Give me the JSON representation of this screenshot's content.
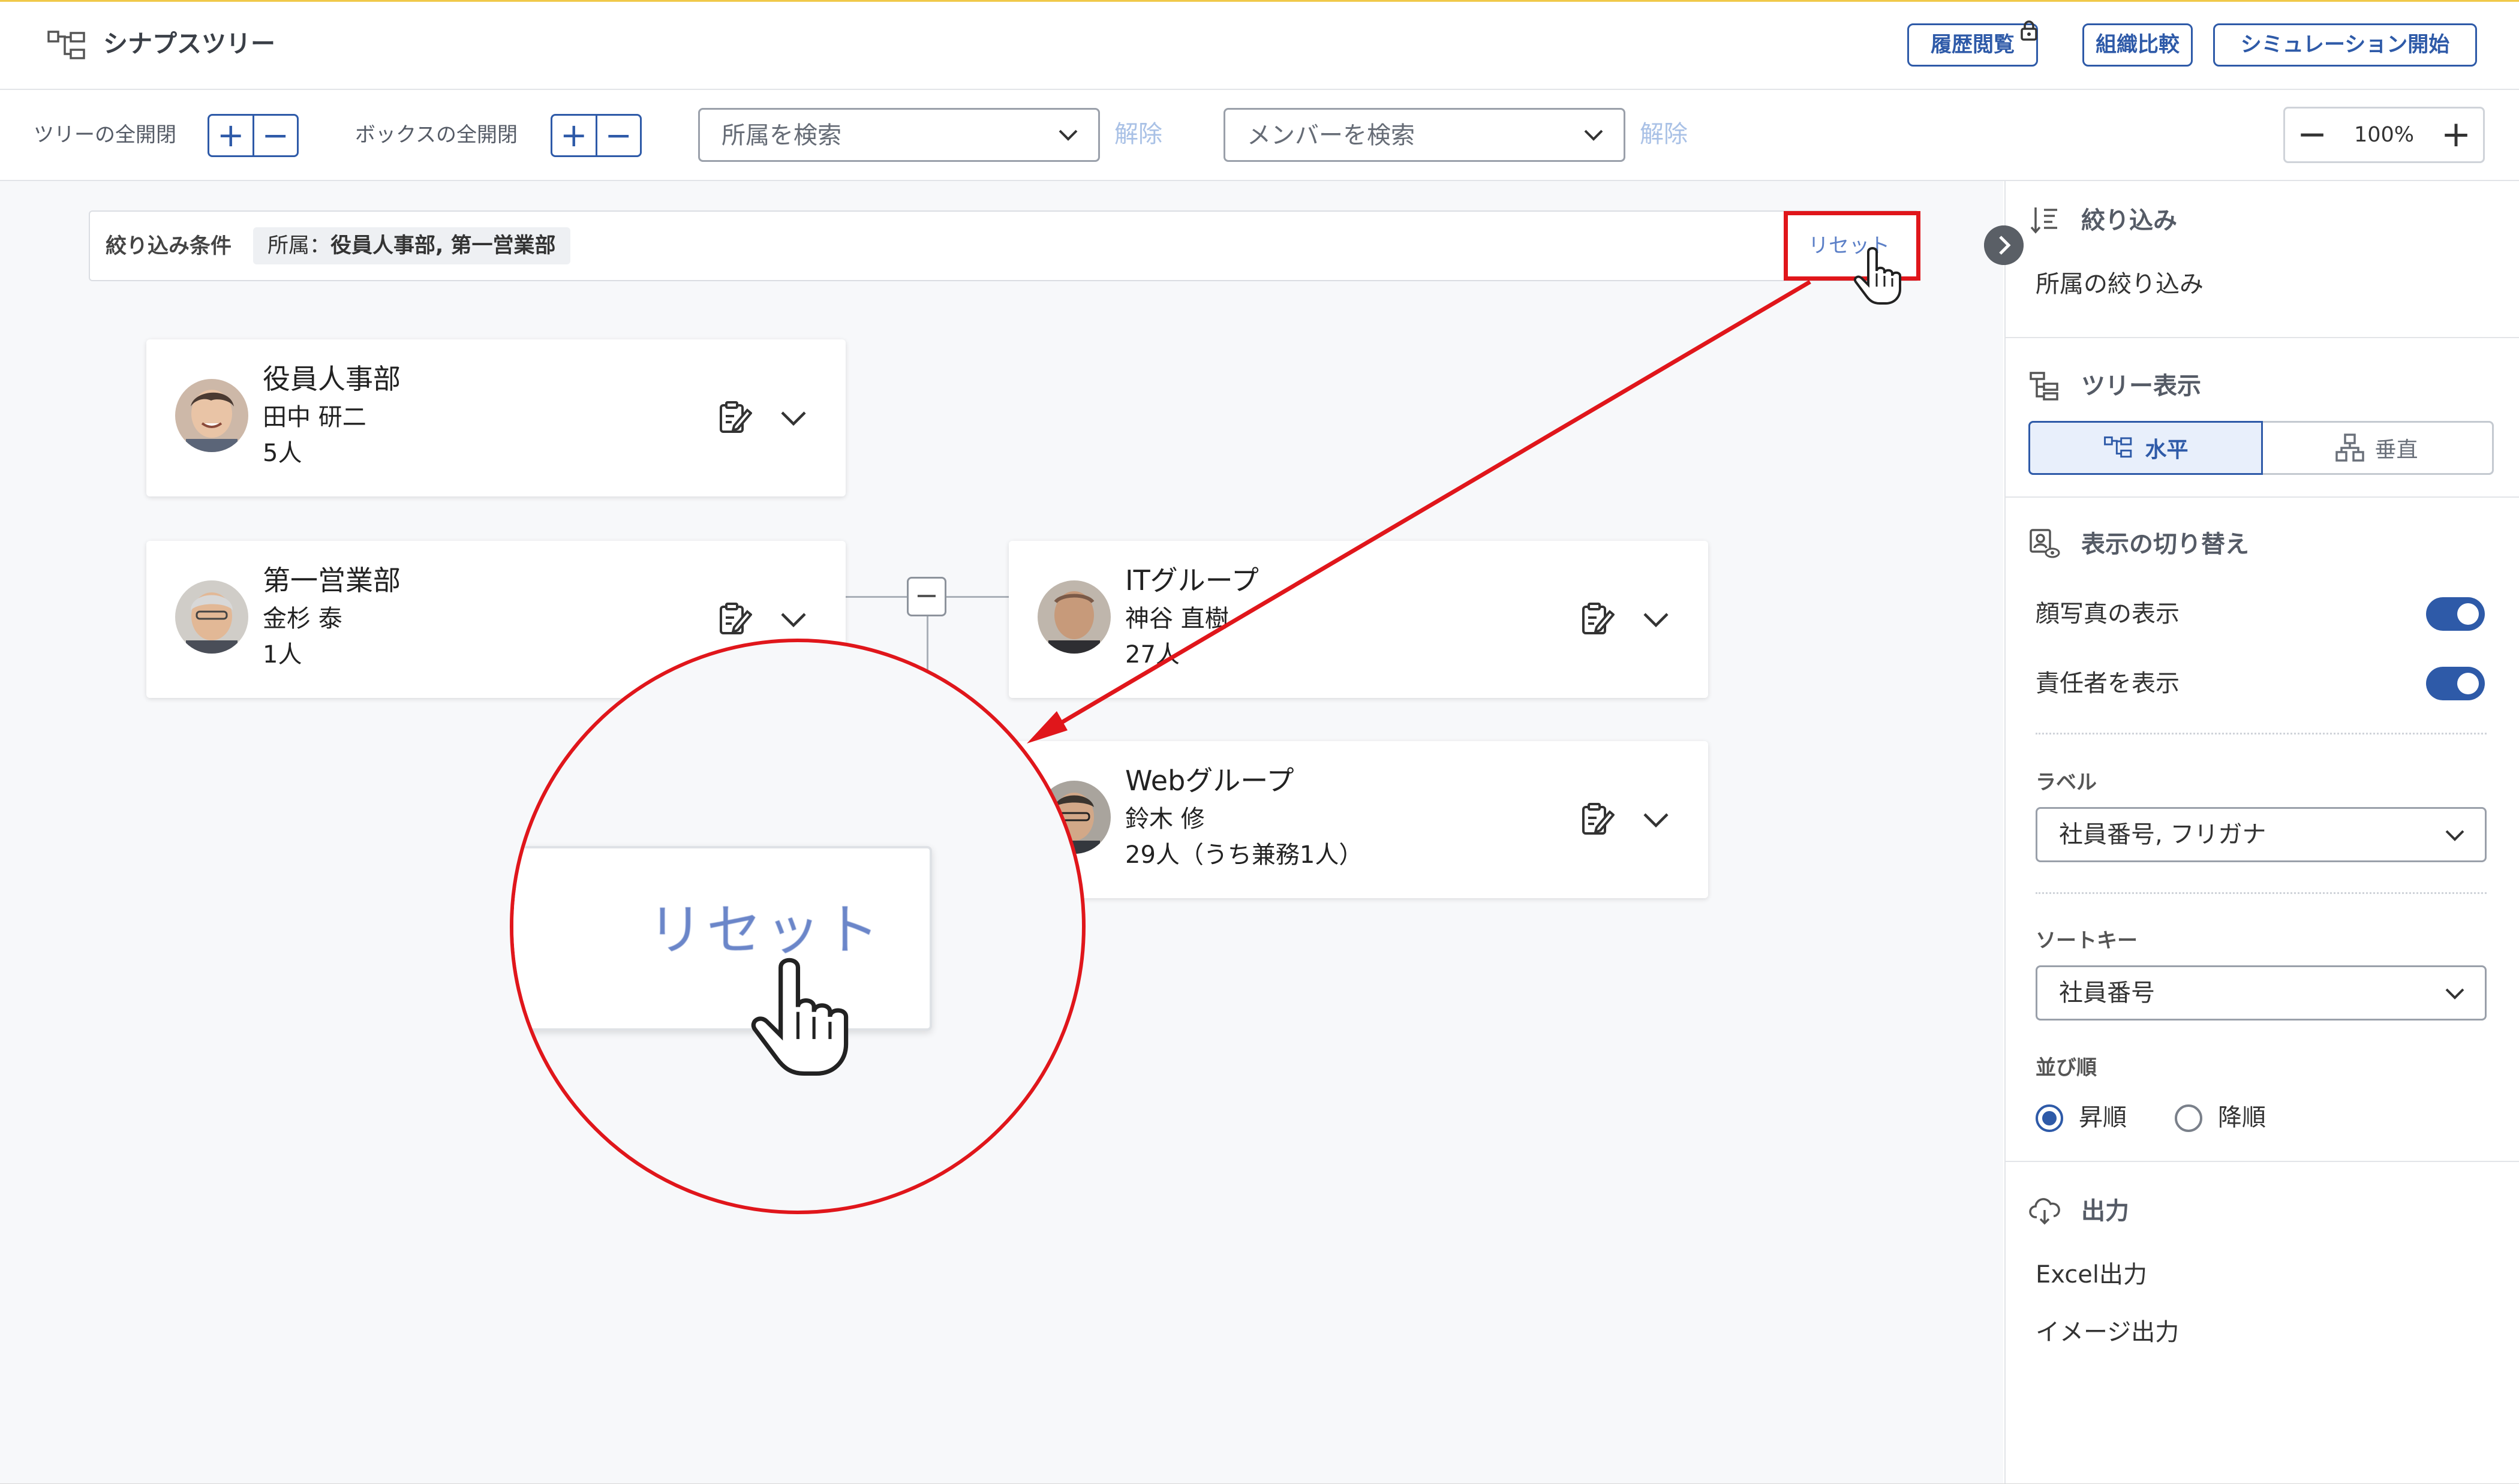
{
  "app": {
    "title": "シナプスツリー"
  },
  "header": {
    "history_label": "履歴閲覧",
    "compare_label": "組織比較",
    "simulation_label": "シミュレーション開始"
  },
  "toolbar": {
    "tree_toggle_label": "ツリーの全開閉",
    "box_toggle_label": "ボックスの全開閉",
    "plus": "+",
    "minus": "−",
    "dept_search_placeholder": "所属を検索",
    "member_search_placeholder": "メンバーを検索",
    "clear_label": "解除",
    "zoom_out": "−",
    "zoom_level": "100%",
    "zoom_in": "+"
  },
  "filter": {
    "label": "絞り込み条件",
    "chip_key": "所属：",
    "chip_value": "役員人事部, 第一営業部",
    "reset_label": "リセット"
  },
  "org_cards": [
    {
      "name": "役員人事部",
      "leader": "田中 研二",
      "count": "5人"
    },
    {
      "name": "第一営業部",
      "leader": "金杉 泰",
      "count": "1人"
    },
    {
      "name": "ITグループ",
      "leader": "神谷 直樹",
      "count": "27人"
    },
    {
      "name": "Webグループ",
      "leader": "鈴木 修",
      "count": "29人（うち兼務1人）"
    }
  ],
  "connector": {
    "collapse_symbol": "−"
  },
  "zoom_callout": {
    "text": "リセット"
  },
  "panel": {
    "filter_title": "絞り込み",
    "filter_item": "所属の絞り込み",
    "tree_title": "ツリー表示",
    "horizontal_label": "水平",
    "vertical_label": "垂直",
    "display_title": "表示の切り替え",
    "face_photo_label": "顔写真の表示",
    "face_photo_on": true,
    "manager_label": "責任者を表示",
    "manager_on": true,
    "label_title": "ラベル",
    "label_value": "社員番号, フリガナ",
    "sort_key_title": "ソートキー",
    "sort_key_value": "社員番号",
    "order_title": "並び順",
    "asc_label": "昇順",
    "desc_label": "降順",
    "order_selected": "asc",
    "output_title": "出力",
    "excel_label": "Excel出力",
    "image_label": "イメージ出力"
  },
  "colors": {
    "accent": "#2e5aa8",
    "highlight": "#e0161b",
    "clear_text": "#a9c1e6"
  }
}
